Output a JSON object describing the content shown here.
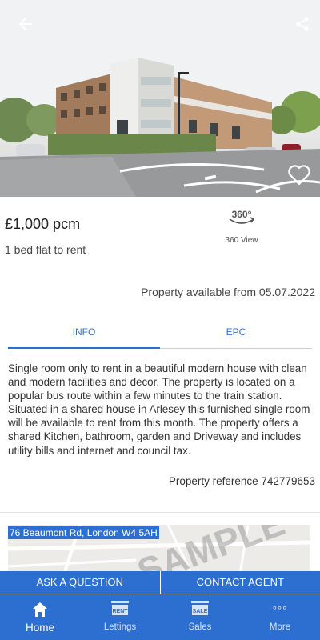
{
  "hero": {
    "icons": {
      "back": "arrow-left-icon",
      "share": "share-icon",
      "favorite": "heart-outline-icon"
    }
  },
  "listing": {
    "price": "£1,000 pcm",
    "type": "1 bed flat to rent",
    "view360_badge": "360°",
    "view360_label": "360 View",
    "available": "Property available from 05.07.2022"
  },
  "tabs": [
    {
      "label": "INFO",
      "active": true
    },
    {
      "label": "EPC",
      "active": false
    }
  ],
  "description": "Single room only to rent in a beautiful modern house with clean and modern facilities and decor. The property is located on a popular bus route within a few minutes to the train station. Situated in a shared house in Arlesey this furnished single room will be available to rent from this month. The property offers a shared Kitchen, bathroom, garden and Driveway and includes utility bills and internet and council tax.",
  "reference": "Property reference 742779653",
  "map": {
    "address": "76 Beaumont Rd, London W4 5AH",
    "watermark": "SAMPLE"
  },
  "actions": {
    "ask": "ASK A QUESTION",
    "contact": "CONTACT AGENT"
  },
  "nav": [
    {
      "label": "Home",
      "icon": "home-icon"
    },
    {
      "label": "Lettings",
      "icon": "rent-sign-icon",
      "sign": "RENT"
    },
    {
      "label": "Sales",
      "icon": "sale-sign-icon",
      "sign": "SALE"
    },
    {
      "label": "More",
      "icon": "more-dots-icon",
      "dots": "°°°"
    }
  ],
  "colors": {
    "accent": "#2d6fd0",
    "text": "#333333"
  }
}
